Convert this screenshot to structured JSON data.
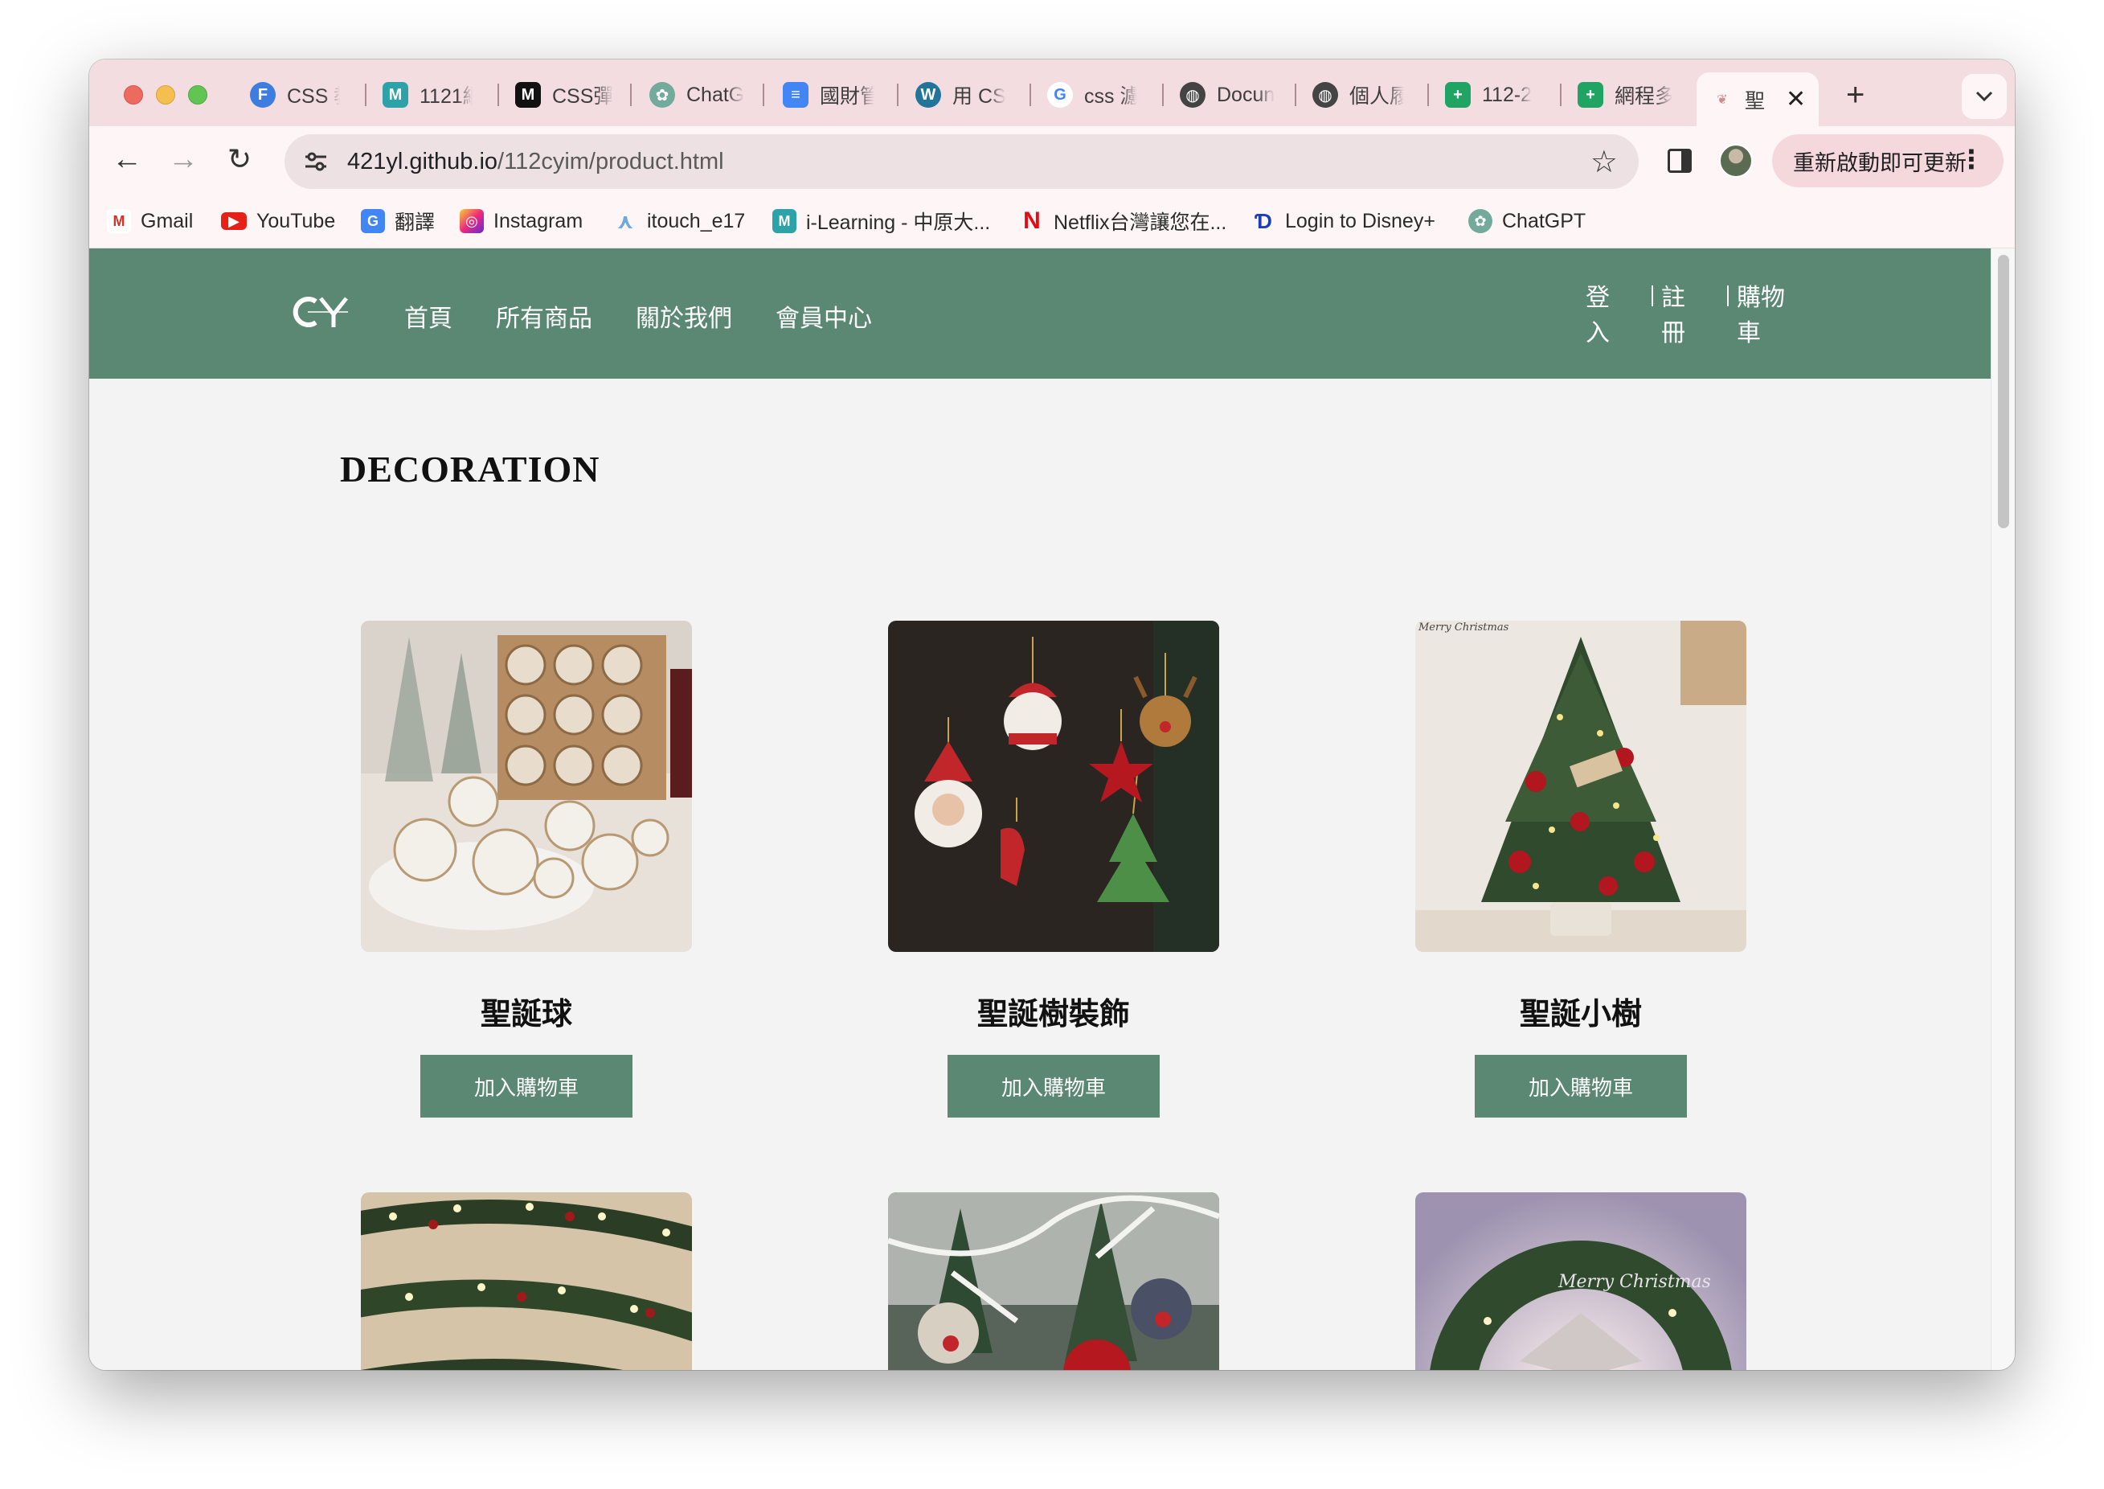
{
  "browser": {
    "tabs": [
      {
        "title": "CSS 教",
        "icon": "f-icon",
        "color": "#3d7de0"
      },
      {
        "title": "1121網",
        "icon": "m-icon",
        "color": "#2ba3a8"
      },
      {
        "title": "CSS彈",
        "icon": "m-black-icon",
        "color": "#111111"
      },
      {
        "title": "ChatG",
        "icon": "chatgpt-icon",
        "color": "#74aa9c"
      },
      {
        "title": "國財管",
        "icon": "docs-icon",
        "color": "#4285f4"
      },
      {
        "title": "用 CSS",
        "icon": "wordpress-icon",
        "color": "#21759b"
      },
      {
        "title": "css 濾",
        "icon": "google-icon",
        "color": "#4285f4"
      },
      {
        "title": "Docun",
        "icon": "globe-icon",
        "color": "#444444"
      },
      {
        "title": "個人履",
        "icon": "globe-icon",
        "color": "#444444"
      },
      {
        "title": "112-2",
        "icon": "sheets-icon",
        "color": "#1fa463"
      },
      {
        "title": "網程多",
        "icon": "sheets-icon",
        "color": "#1fa463"
      },
      {
        "title": "聖",
        "icon": "site-icon",
        "color": "#d58a8a"
      }
    ],
    "url_host": "421yl.github.io",
    "url_path": "/112cyim/product.html",
    "update_label": "重新啟動即可更新",
    "bookmarks": [
      {
        "label": "Gmail",
        "icon": "gmail-icon"
      },
      {
        "label": "YouTube",
        "icon": "youtube-icon"
      },
      {
        "label": "翻譯",
        "icon": "translate-icon"
      },
      {
        "label": "Instagram",
        "icon": "instagram-icon"
      },
      {
        "label": "itouch_e17",
        "icon": "itouch-icon"
      },
      {
        "label": "i-Learning - 中原大...",
        "icon": "m-icon"
      },
      {
        "label": "Netflix台灣讓您在...",
        "icon": "netflix-icon"
      },
      {
        "label": "Login to Disney+",
        "icon": "disney-icon"
      },
      {
        "label": "ChatGPT",
        "icon": "chatgpt-icon"
      }
    ]
  },
  "site": {
    "logo_text": "CY",
    "nav": [
      "首頁",
      "所有商品",
      "關於我們",
      "會員中心"
    ],
    "user_nav": [
      "登入",
      "註冊",
      "購物車"
    ],
    "section_title": "DECORATION",
    "add_to_cart_label": "加入購物車",
    "products": [
      {
        "name": "聖誕球",
        "image": "ornament-balls-photo"
      },
      {
        "name": "聖誕樹裝飾",
        "image": "felt-ornaments-photo"
      },
      {
        "name": "聖誕小樹",
        "image": "mini-tree-photo",
        "image_text": "Merry Christmas"
      },
      {
        "name": "",
        "image": "garland-lights-photo"
      },
      {
        "name": "",
        "image": "reindeer-ornaments-photo"
      },
      {
        "name": "",
        "image": "wreath-photo",
        "image_text": "Merry Christmas"
      }
    ]
  }
}
